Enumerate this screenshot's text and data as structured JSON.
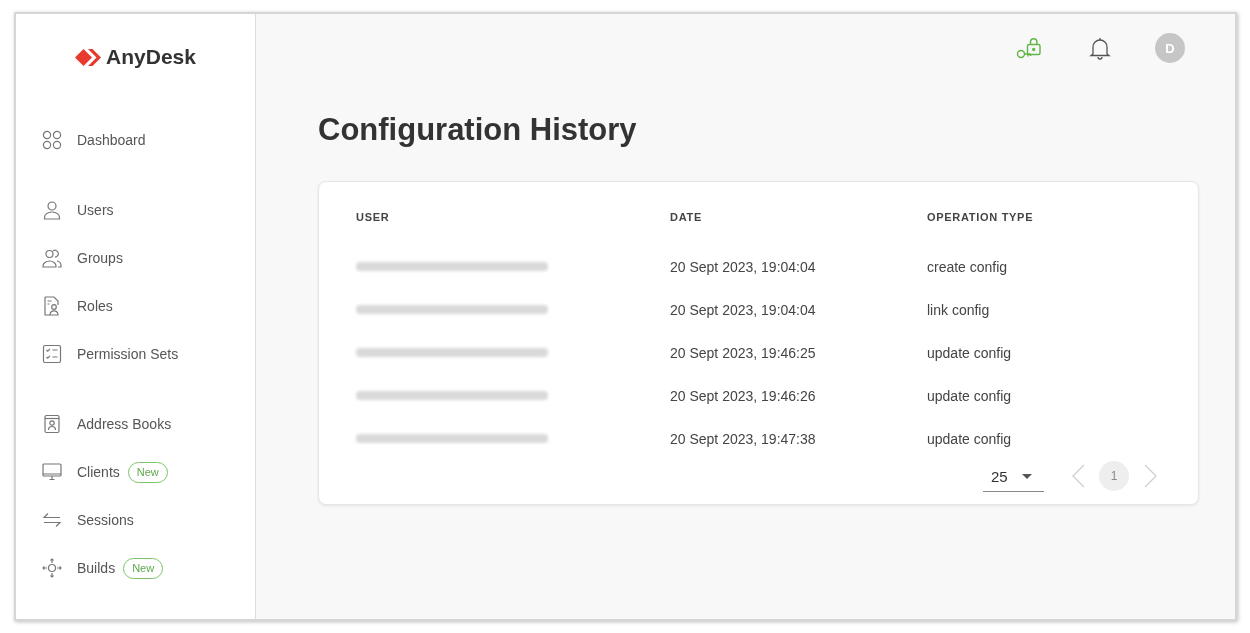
{
  "logo": {
    "text": "AnyDesk"
  },
  "sidebar": {
    "sections": [
      {
        "items": [
          {
            "label": "Dashboard",
            "selected": false
          }
        ]
      },
      {
        "items": [
          {
            "label": "Users",
            "selected": false
          },
          {
            "label": "Groups",
            "selected": false
          },
          {
            "label": "Roles",
            "selected": false
          },
          {
            "label": "Permission Sets",
            "selected": false
          }
        ]
      },
      {
        "items": [
          {
            "label": "Address Books",
            "selected": false
          },
          {
            "label": "Clients",
            "selected": false,
            "badge": "New"
          },
          {
            "label": "Sessions",
            "selected": false
          },
          {
            "label": "Builds",
            "selected": false,
            "badge": "New"
          }
        ]
      }
    ]
  },
  "header": {
    "avatar": {
      "initial": "D"
    }
  },
  "page": {
    "title": "Configuration History"
  },
  "table": {
    "columns": [
      "USER",
      "DATE",
      "OPERATION TYPE"
    ],
    "rows": [
      {
        "date": "20 Sept 2023, 19:04:04",
        "operation_type": "create config"
      },
      {
        "date": "20 Sept 2023, 19:04:04",
        "operation_type": "link config"
      },
      {
        "date": "20 Sept 2023, 19:46:25",
        "operation_type": "update config"
      },
      {
        "date": "20 Sept 2023, 19:46:26",
        "operation_type": "update config"
      },
      {
        "date": "20 Sept 2023, 19:47:38",
        "operation_type": "update config"
      }
    ]
  },
  "pagination": {
    "page_size": "25",
    "previous": {
      "disabled": true
    },
    "pages": [
      {
        "label": "1",
        "selected": true
      }
    ],
    "next": {
      "disabled": true
    }
  }
}
